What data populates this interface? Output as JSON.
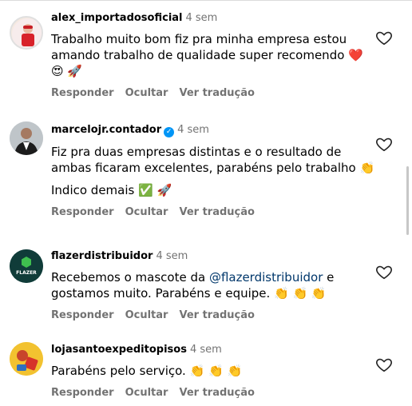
{
  "comments": [
    {
      "username": "alex_importadosoficial",
      "time": "4 sem",
      "verified": false,
      "paragraphs": [
        {
          "before": "Trabalho muito bom fiz pra minha empresa estou amando trabalho de qualidade super recomendo ❤️",
          "mention": "",
          "after": "",
          "line2": "😍 🚀"
        }
      ],
      "actions": [
        "Responder",
        "Ocultar",
        "Ver tradução"
      ]
    },
    {
      "username": "marcelojr.contador",
      "time": "4 sem",
      "verified": true,
      "paragraphs": [
        {
          "before": "Fiz pra duas empresas distintas e o resultado de ambas ficaram excelentes, parabéns pelo trabalho 👏",
          "mention": "",
          "after": ""
        },
        {
          "before": "Indico demais ✅ 🚀",
          "mention": "",
          "after": ""
        }
      ],
      "actions": [
        "Responder",
        "Ocultar",
        "Ver tradução"
      ]
    },
    {
      "username": "flazerdistribuidor",
      "time": "4 sem",
      "verified": false,
      "paragraphs": [
        {
          "before": "Recebemos o mascote da ",
          "mention": "@flazerdistribuidor",
          "after": " e gostamos muito. Parabéns e equipe. 👏 👏 👏"
        }
      ],
      "actions": [
        "Responder",
        "Ocultar",
        "Ver tradução"
      ]
    },
    {
      "username": "lojasantoexpeditopisos",
      "time": "4 sem",
      "verified": false,
      "paragraphs": [
        {
          "before": "Parabéns pelo serviço. 👏 👏 👏",
          "mention": "",
          "after": ""
        }
      ],
      "actions": [
        "Responder",
        "Ocultar",
        "Ver tradução"
      ]
    }
  ],
  "avatars": {
    "flazer_logo_text": "FLAZER"
  },
  "colors": {
    "username": "#000000",
    "secondary": "#737373",
    "mention": "#00376b",
    "verified": "#0095f6"
  }
}
